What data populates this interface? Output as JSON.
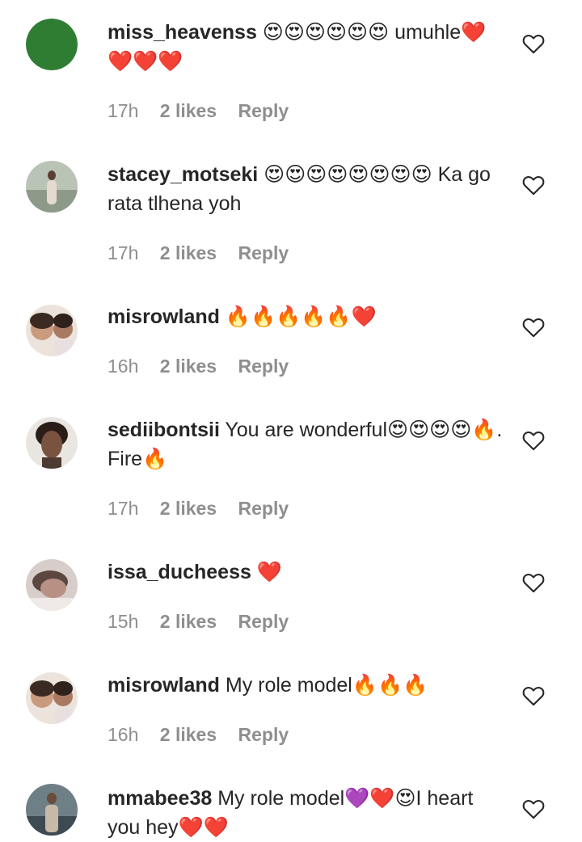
{
  "comments": [
    {
      "username": "miss_heavenss",
      "text": " 😍😍😍😍😍😍 umuhle❤️❤️❤️❤️",
      "time": "17h",
      "likes": "2 likes",
      "reply": "Reply",
      "avatar_color": "#2e7d32"
    },
    {
      "username": "stacey_motseki",
      "text": " 😍😍😍😍😍😍😍😍 Ka go rata tlhena yoh",
      "time": "17h",
      "likes": "2 likes",
      "reply": "Reply",
      "avatar_color": "#9aa89a"
    },
    {
      "username": "misrowland",
      "text": " 🔥🔥🔥🔥🔥❤️",
      "time": "16h",
      "likes": "2 likes",
      "reply": "Reply",
      "avatar_color": "#c9a58f"
    },
    {
      "username": "sediibontsii",
      "text": " You are wonderful😍😍😍😍🔥. Fire🔥",
      "time": "17h",
      "likes": "2 likes",
      "reply": "Reply",
      "avatar_color": "#6b4a3a"
    },
    {
      "username": "issa_ducheess",
      "text": " ❤️",
      "time": "15h",
      "likes": "2 likes",
      "reply": "Reply",
      "avatar_color": "#a98f8a"
    },
    {
      "username": "misrowland",
      "text": " My role model🔥🔥🔥",
      "time": "16h",
      "likes": "2 likes",
      "reply": "Reply",
      "avatar_color": "#c9a58f"
    },
    {
      "username": "mmabee38",
      "text": " My role model💜❤️😍I heart you hey❤️❤️",
      "time": "",
      "likes": "",
      "reply": "",
      "avatar_color": "#5a6b7a"
    }
  ],
  "icons": {
    "like": "heart-outline-icon"
  },
  "colors": {
    "meta_gray": "#8e8e8e",
    "text": "#262626"
  }
}
